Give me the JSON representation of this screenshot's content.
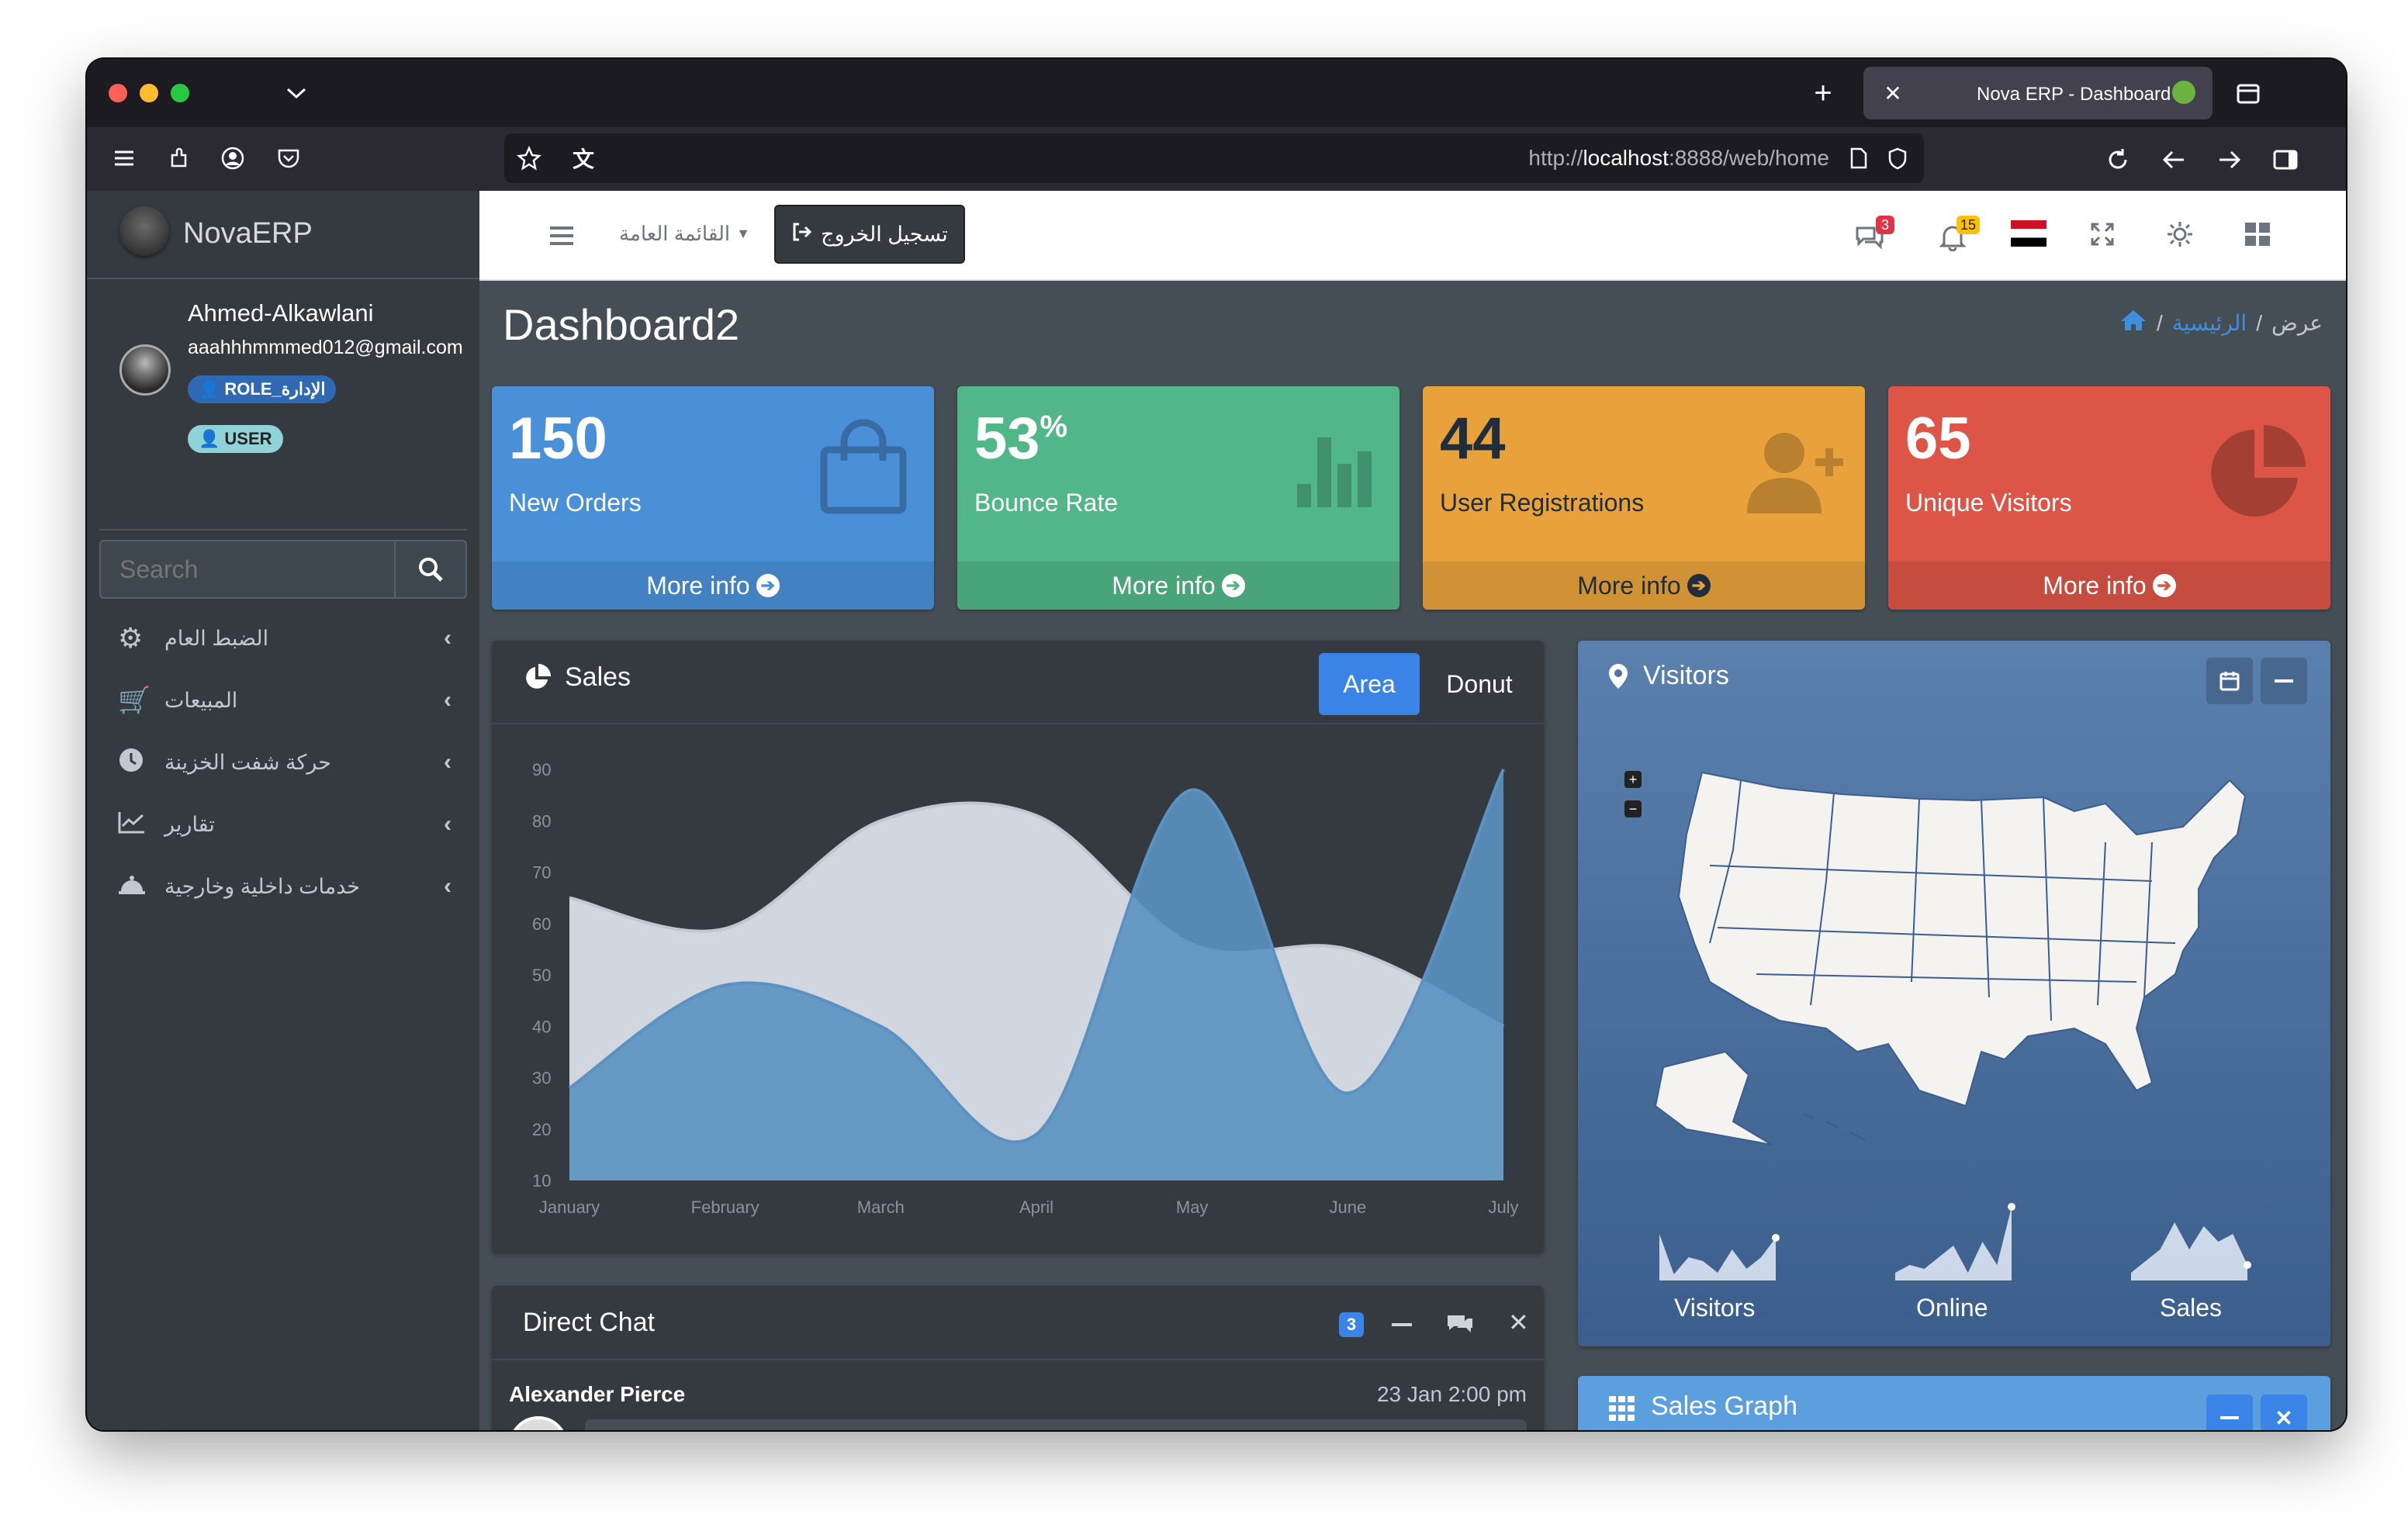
{
  "browser": {
    "tab_title": "Nova ERP - Dashboard",
    "url_prefix": "http://",
    "url_host": "localhost",
    "url_rest": ":8888/web/home"
  },
  "sidebar": {
    "brand": "NovaERP",
    "user": {
      "name": "Ahmed-Alkawlani",
      "email": "aaahhhmmmed012@gmail.com",
      "role1": "ROLE_الإدارة",
      "role2": "USER"
    },
    "search": {
      "placeholder": "Search"
    },
    "items": [
      {
        "label": "الضبط العام",
        "icon": "gear-icon"
      },
      {
        "label": "المبيعات",
        "icon": "cart-icon"
      },
      {
        "label": "حركة شفت الخزينة",
        "icon": "clock-icon"
      },
      {
        "label": "تقارير",
        "icon": "chart-icon"
      },
      {
        "label": "خدمات داخلية وخارجية",
        "icon": "bell-service-icon"
      }
    ]
  },
  "topnav": {
    "menu_label": "القائمة العامة",
    "logout_label": "تسجيل الخروج",
    "messages_count": "3",
    "notifications_count": "15"
  },
  "page": {
    "title": "Dashboard2",
    "breadcrumb": {
      "home": "الرئيسية",
      "current": "عرض"
    }
  },
  "boxes": [
    {
      "value": "150",
      "sup": "",
      "label": "New Orders",
      "more": "More info",
      "color": "#4a90d9"
    },
    {
      "value": "53",
      "sup": "%",
      "label": "Bounce Rate",
      "more": "More info",
      "color": "#52b788"
    },
    {
      "value": "44",
      "sup": "",
      "label": "User Registrations",
      "more": "More info",
      "color": "#e9a23b"
    },
    {
      "value": "65",
      "sup": "",
      "label": "Unique Visitors",
      "more": "More info",
      "color": "#dc5546"
    }
  ],
  "sales": {
    "title": "Sales",
    "tab_area": "Area",
    "tab_donut": "Donut"
  },
  "chart_data": {
    "type": "area",
    "categories": [
      "January",
      "February",
      "March",
      "April",
      "May",
      "June",
      "July"
    ],
    "ylim": [
      10,
      90
    ],
    "yticks": [
      10,
      20,
      30,
      40,
      50,
      60,
      70,
      80,
      90
    ],
    "series": [
      {
        "values": [
          65,
          59,
          80,
          81,
          56,
          55,
          40
        ],
        "color": "#d2d6de"
      },
      {
        "values": [
          28,
          48,
          40,
          19,
          86,
          27,
          90
        ],
        "color": "#5b92c2"
      }
    ]
  },
  "visitors": {
    "title": "Visitors",
    "sparks": [
      "Visitors",
      "Online",
      "Sales"
    ]
  },
  "chat": {
    "title": "Direct Chat",
    "badge": "3",
    "sender": "Alexander Pierce",
    "time": "23 Jan 2:00 pm"
  },
  "sales_graph": {
    "title": "Sales Graph"
  }
}
